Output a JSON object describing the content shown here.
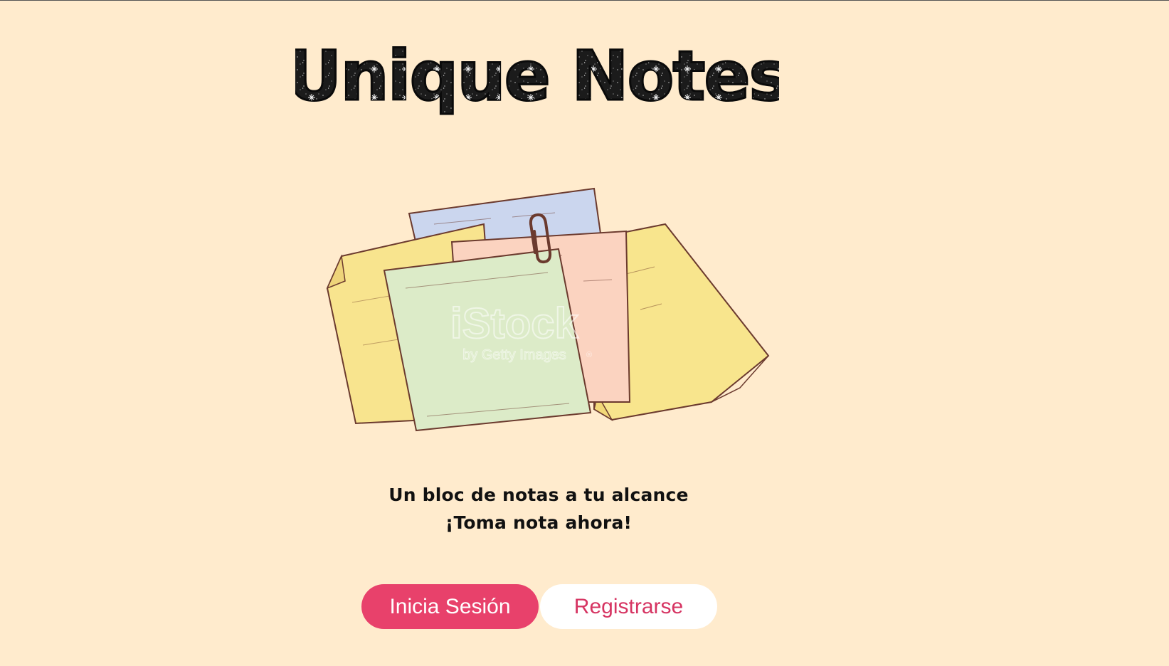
{
  "logo": {
    "text": "Unique Notes"
  },
  "hero": {
    "watermark": "iStock",
    "watermark_sub": "by Getty Images",
    "watermark_reg": "®"
  },
  "tagline": {
    "line1": "Un bloc de notas a tu alcance",
    "line2": "¡Toma nota ahora!"
  },
  "actions": {
    "login_label": "Inicia Sesión",
    "register_label": "Registrarse"
  },
  "colors": {
    "background": "#ffebcd",
    "primary": "#e8416b",
    "secondary_text": "#d63462"
  }
}
